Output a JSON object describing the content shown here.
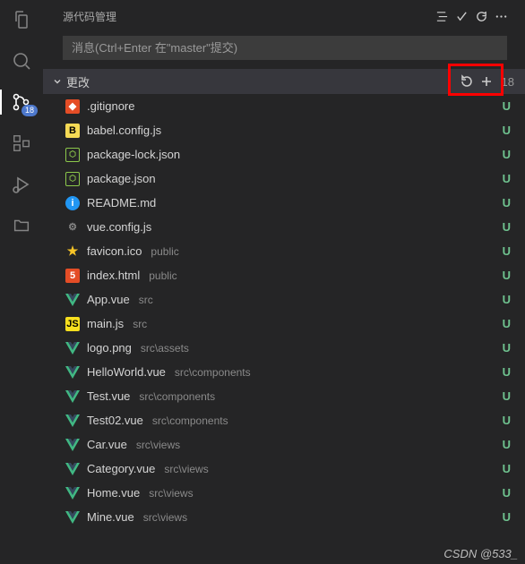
{
  "activity_bar": {
    "badge": "18"
  },
  "panel": {
    "title": "源代码管理"
  },
  "commit": {
    "placeholder": "消息(Ctrl+Enter 在\"master\"提交)"
  },
  "section": {
    "label": "更改",
    "count": "18"
  },
  "status_letters": {
    "untracked": "U"
  },
  "files": [
    {
      "icon": "git",
      "name": ".gitignore",
      "path": ""
    },
    {
      "icon": "babel",
      "name": "babel.config.js",
      "path": ""
    },
    {
      "icon": "node",
      "name": "package-lock.json",
      "path": ""
    },
    {
      "icon": "node",
      "name": "package.json",
      "path": ""
    },
    {
      "icon": "info",
      "name": "README.md",
      "path": ""
    },
    {
      "icon": "gear",
      "name": "vue.config.js",
      "path": ""
    },
    {
      "icon": "star",
      "name": "favicon.ico",
      "path": "public"
    },
    {
      "icon": "html",
      "name": "index.html",
      "path": "public"
    },
    {
      "icon": "vue",
      "name": "App.vue",
      "path": "src"
    },
    {
      "icon": "js",
      "name": "main.js",
      "path": "src"
    },
    {
      "icon": "vue",
      "name": "logo.png",
      "path": "src\\assets"
    },
    {
      "icon": "vue",
      "name": "HelloWorld.vue",
      "path": "src\\components"
    },
    {
      "icon": "vue",
      "name": "Test.vue",
      "path": "src\\components"
    },
    {
      "icon": "vue",
      "name": "Test02.vue",
      "path": "src\\components"
    },
    {
      "icon": "vue",
      "name": "Car.vue",
      "path": "src\\views"
    },
    {
      "icon": "vue",
      "name": "Category.vue",
      "path": "src\\views"
    },
    {
      "icon": "vue",
      "name": "Home.vue",
      "path": "src\\views"
    },
    {
      "icon": "vue",
      "name": "Mine.vue",
      "path": "src\\views"
    }
  ],
  "watermark": "CSDN @533_"
}
